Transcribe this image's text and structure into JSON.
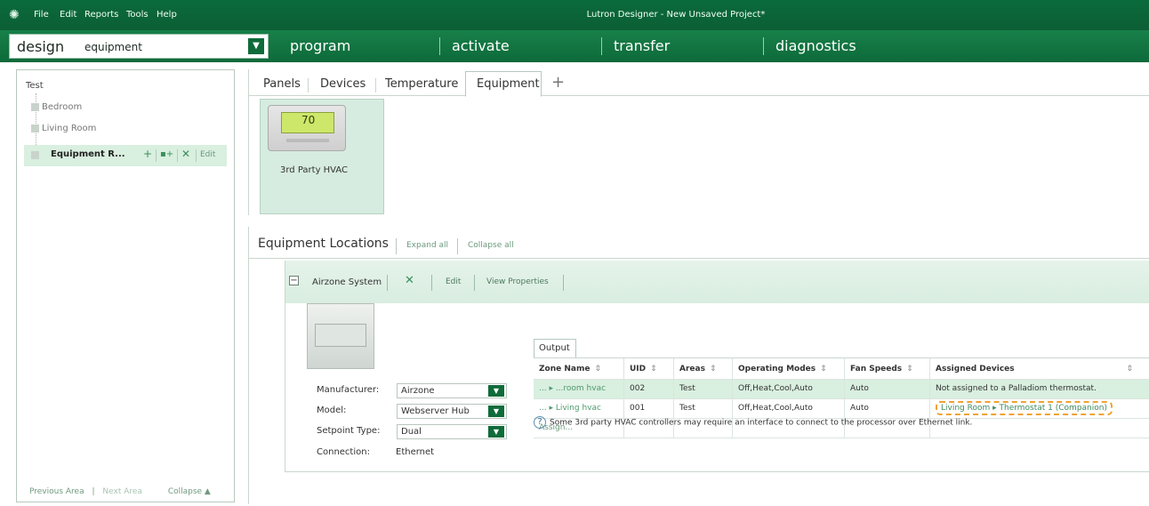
{
  "titlebar": {
    "menu": [
      "File",
      "Edit",
      "Reports",
      "Tools",
      "Help"
    ],
    "title": "Lutron Designer - New Unsaved Project*"
  },
  "nav": {
    "design_label": "design",
    "design_dropdown_value": "equipment",
    "items": [
      "program",
      "activate",
      "transfer",
      "diagnostics"
    ]
  },
  "tree": {
    "root": "Test",
    "nodes": [
      "Bedroom",
      "Living Room"
    ],
    "selected": "Equipment R...",
    "selected_edit": "Edit",
    "footer_prev": "Previous Area",
    "footer_sep": "|",
    "footer_next": "Next Area",
    "footer_collapse": "Collapse ▲"
  },
  "tabs": {
    "items": [
      "Panels",
      "Devices",
      "Temperature",
      "Equipment"
    ],
    "active": "Equipment",
    "add": "+"
  },
  "device_tile": {
    "label": "3rd Party HVAC",
    "display_temp": "70"
  },
  "equipment_locations": {
    "title": "Equipment Locations",
    "expand_all": "Expand all",
    "collapse_all": "Collapse all"
  },
  "system": {
    "name": "Airzone System",
    "edit": "Edit",
    "view_properties": "View Properties",
    "props": {
      "manufacturer_label": "Manufacturer:",
      "manufacturer_value": "Airzone",
      "model_label": "Model:",
      "model_value": "Webserver Hub",
      "setpoint_label": "Setpoint Type:",
      "setpoint_value": "Dual",
      "connection_label": "Connection:",
      "connection_value": "Ethernet"
    }
  },
  "output": {
    "tab_label": "Output",
    "columns": [
      "Zone Name",
      "UID",
      "Areas",
      "Operating Modes",
      "Fan Speeds",
      "Assigned Devices"
    ],
    "rows": [
      {
        "zone": "... ▸ ...room hvac",
        "uid": "002",
        "areas": "Test",
        "modes": "Off,Heat,Cool,Auto",
        "fan": "Auto",
        "assigned": "Not assigned to a Palladiom thermostat."
      },
      {
        "zone": "... ▸ Living hvac",
        "uid": "001",
        "areas": "Test",
        "modes": "Off,Heat,Cool,Auto",
        "fan": "Auto",
        "assigned": "Living Room ▸ Thermostat 1 (Companion)"
      }
    ],
    "assign_link": "Assign...",
    "note": "Some 3rd party HVAC controllers may require an interface to connect to the processor over Ethernet link."
  },
  "colors": {
    "brand_green": "#0d6a3a",
    "selection_green": "#d9efdf",
    "highlight_orange": "#f0a231"
  }
}
